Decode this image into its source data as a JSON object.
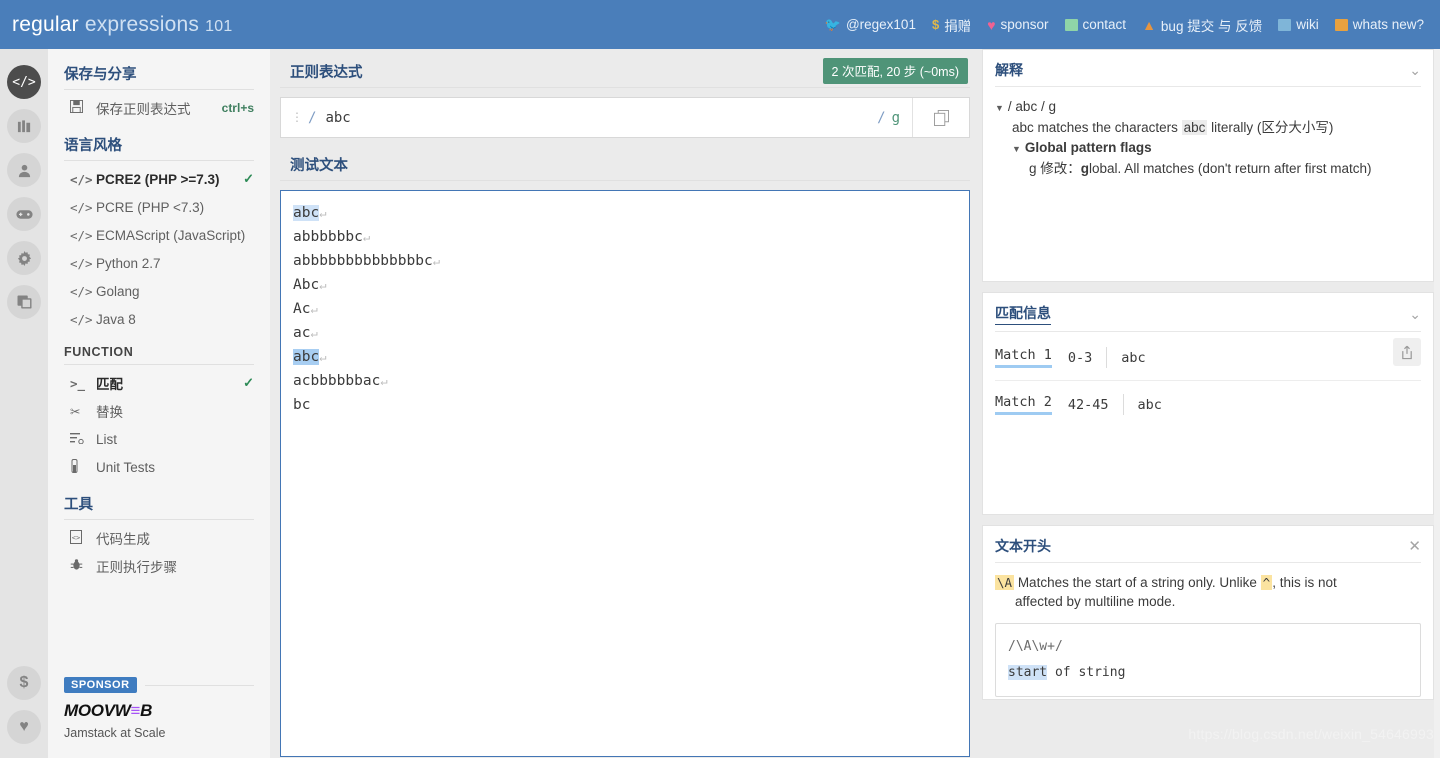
{
  "topbar": {
    "logo_bold": "regular",
    "logo_light": "expressions",
    "logo_num": "101",
    "links": [
      {
        "icon": "twitter-icon",
        "label": "@regex101",
        "color": "#4aa3e0"
      },
      {
        "icon": "dollar-icon",
        "label": "捐赠",
        "color": "#e0b84a"
      },
      {
        "icon": "heart-icon",
        "label": "sponsor",
        "color": "#f06292"
      },
      {
        "icon": "mail-icon",
        "label": "contact",
        "color": "#8fd4a8"
      },
      {
        "icon": "warning-icon",
        "label": "bug 提交 与 反馈",
        "color": "#e8953f"
      },
      {
        "icon": "wiki-icon",
        "label": "wiki",
        "color": "#7fb5d8"
      },
      {
        "icon": "news-icon",
        "label": "whats new?",
        "color": "#e8a13f"
      }
    ]
  },
  "rail": {
    "items": [
      {
        "name": "code-icon",
        "glyph": "</>",
        "active": true
      },
      {
        "name": "library-icon",
        "glyph": "▥",
        "active": false
      },
      {
        "name": "account-icon",
        "glyph": "👤",
        "active": false
      },
      {
        "name": "gamepad-icon",
        "glyph": "🎮",
        "active": false
      },
      {
        "name": "gear-icon",
        "glyph": "⚙",
        "active": false
      },
      {
        "name": "community-icon",
        "glyph": "🗗",
        "active": false
      }
    ],
    "bottom": [
      {
        "name": "donate-icon",
        "glyph": "$"
      },
      {
        "name": "sponsor-heart-icon",
        "glyph": "♥"
      }
    ]
  },
  "sidebar": {
    "save_header": "保存与分享",
    "save_item": {
      "icon": "floppy-icon",
      "label": "保存正则表达式",
      "shortcut": "ctrl+s"
    },
    "flavor_header": "语言风格",
    "flavors": [
      {
        "label": "PCRE2 (PHP >=7.3)",
        "selected": true
      },
      {
        "label": "PCRE (PHP <7.3)",
        "selected": false
      },
      {
        "label": "ECMAScript (JavaScript)",
        "selected": false
      },
      {
        "label": "Python 2.7",
        "selected": false
      },
      {
        "label": "Golang",
        "selected": false
      },
      {
        "label": "Java 8",
        "selected": false
      }
    ],
    "function_header": "FUNCTION",
    "functions": [
      {
        "icon": "terminal-icon",
        "label": "匹配",
        "selected": true
      },
      {
        "icon": "scissors-icon",
        "label": "替换",
        "selected": false
      },
      {
        "icon": "list-icon",
        "label": "List",
        "selected": false
      },
      {
        "icon": "flask-icon",
        "label": "Unit Tests",
        "selected": false
      }
    ],
    "tools_header": "工具",
    "tools": [
      {
        "icon": "code-file-icon",
        "label": "代码生成"
      },
      {
        "icon": "bug-icon",
        "label": "正则执行步骤"
      }
    ],
    "sponsor": {
      "tag": "SPONSOR",
      "logo_a": "MOOVW",
      "logo_bars": "≡",
      "logo_b": "B",
      "tagline": "Jamstack at Scale"
    }
  },
  "center": {
    "regex_title": "正则表达式",
    "match_badge": "2 次匹配, 20 步 (~0ms)",
    "regex_open_slash": "/",
    "regex_value": "abc",
    "flag_slash": "/",
    "flags": "g",
    "test_title": "测试文本",
    "test_lines": [
      {
        "text": "abc",
        "highlight": "light",
        "pilcrow": true
      },
      {
        "text": "abbbbbbc",
        "highlight": "none",
        "pilcrow": true
      },
      {
        "text": "abbbbbbbbbbbbbbc",
        "highlight": "none",
        "pilcrow": true
      },
      {
        "text": "Abc",
        "highlight": "none",
        "pilcrow": true
      },
      {
        "text": "Ac",
        "highlight": "none",
        "pilcrow": true
      },
      {
        "text": "ac",
        "highlight": "none",
        "pilcrow": true
      },
      {
        "text": "abc",
        "highlight": "strong",
        "pilcrow": true
      },
      {
        "text": "acbbbbbbac",
        "highlight": "none",
        "pilcrow": true
      },
      {
        "text": "bc",
        "highlight": "none",
        "pilcrow": false
      }
    ]
  },
  "explanation": {
    "title": "解释",
    "pattern_line": "/ abc / g",
    "literal_pre": "abc matches the characters ",
    "literal_tok": "abc",
    "literal_post": " literally (区分大小写)",
    "flags_header": "Global pattern flags",
    "flag_key": "g",
    "flag_label": "修改：",
    "flag_bold": "g",
    "flag_desc": "lobal. All matches (don't return after first match)"
  },
  "match_info": {
    "title": "匹配信息",
    "share_icon": "share-icon",
    "matches": [
      {
        "label": "Match 1",
        "range": "0-3",
        "value": "abc"
      },
      {
        "label": "Match 2",
        "range": "42-45",
        "value": "abc"
      }
    ]
  },
  "reference": {
    "title": "文本开头",
    "token": "\\A",
    "desc_a": " Matches the start of a string only. Unlike ",
    "token2": "^",
    "desc_b": ", this is not",
    "desc_c": "affected by multiline mode.",
    "code_pattern": "/\\A\\w+/",
    "code_hl": "start",
    "code_rest": " of string"
  },
  "watermark": "https://blog.csdn.net/weixin_54646993"
}
